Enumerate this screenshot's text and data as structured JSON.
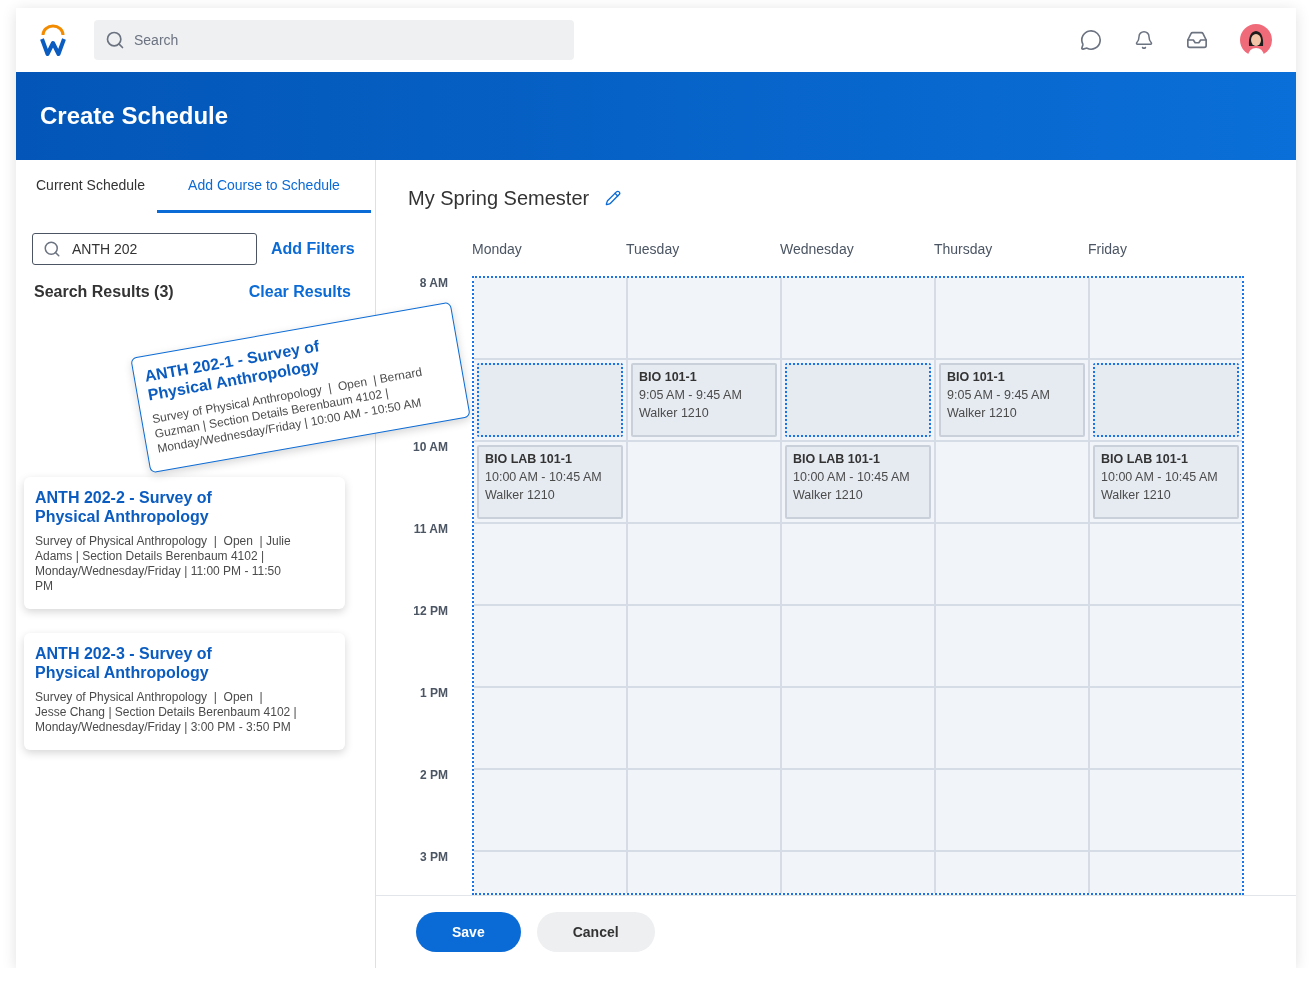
{
  "app_bar": {
    "search": {
      "placeholder": "Search"
    }
  },
  "page_title": "Create Schedule",
  "tabs": [
    {
      "label": "Current Schedule",
      "selected": false
    },
    {
      "label": "Add Course to Schedule",
      "selected": true
    }
  ],
  "course_search": {
    "value": "ANTH 202",
    "add_filters": "Add Filters"
  },
  "results": {
    "heading": "Search Results (3)",
    "clear": "Clear Results",
    "items": [
      {
        "title": "ANTH 202-1 - Survey of Physical Anthropology",
        "details": "Survey of Physical Anthropology  |  Open  | Bernard Guzman | Section Details Berenbaum 4102 | Monday/Wednesday/Friday | 10:00 AM - 10:50 AM",
        "dragging": true
      },
      {
        "title": "ANTH 202-2 - Survey of Physical Anthropology",
        "details": "Survey of Physical Anthropology  |  Open  | Julie Adams | Section Details Berenbaum 4102 | Monday/Wednesday/Friday | 11:00 PM - 11:50 PM",
        "dragging": false
      },
      {
        "title": "ANTH 202-3 - Survey of Physical Anthropology",
        "details": "Survey of Physical Anthropology  |  Open  | Jesse Chang | Section Details Berenbaum 4102 | Monday/Wednesday/Friday | 3:00 PM - 3:50 PM",
        "dragging": false
      }
    ]
  },
  "schedule": {
    "title": "My Spring Semester",
    "days": [
      "Monday",
      "Tuesday",
      "Wednesday",
      "Thursday",
      "Friday"
    ],
    "drop_zone_active": true,
    "rows": [
      {
        "time": "8 AM"
      },
      {
        "cells": [
          {
            "kind": "drop_target"
          },
          {
            "kind": "event",
            "title": "BIO 101-1",
            "time": "9:05 AM - 9:45 AM",
            "room": "Walker 1210"
          },
          {
            "kind": "drop_target"
          },
          {
            "kind": "event",
            "title": "BIO 101-1",
            "time": "9:05 AM - 9:45 AM",
            "room": "Walker 1210"
          },
          {
            "kind": "drop_target"
          }
        ]
      },
      {
        "time": "10 AM",
        "cells": [
          {
            "kind": "event",
            "title": "BIO LAB 101-1",
            "time": "10:00 AM - 10:45 AM",
            "room": "Walker 1210"
          },
          {
            "kind": "empty"
          },
          {
            "kind": "event",
            "title": "BIO LAB 101-1",
            "time": "10:00 AM - 10:45 AM",
            "room": "Walker 1210"
          },
          {
            "kind": "empty"
          },
          {
            "kind": "event",
            "title": "BIO LAB 101-1",
            "time": "10:00 AM - 10:45 AM",
            "room": "Walker 1210"
          }
        ]
      },
      {
        "time": "11 AM"
      },
      {
        "time": "12 PM"
      },
      {
        "time": "1 PM"
      },
      {
        "time": "2 PM"
      },
      {
        "time": "3 PM"
      }
    ]
  },
  "buttons": [
    {
      "label": "Save",
      "kind": "primary"
    },
    {
      "label": "Cancel",
      "kind": "secondary"
    }
  ]
}
